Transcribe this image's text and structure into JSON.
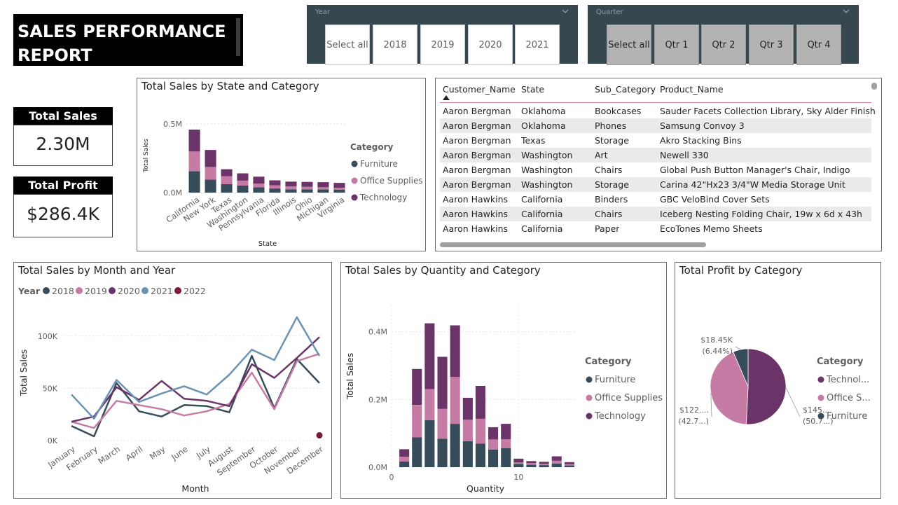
{
  "title": "SALES PERFORMANCE REPORT",
  "title_lines": [
    "SALES PERFORMANCE",
    "REPORT"
  ],
  "slicers": {
    "year": {
      "label": "Year",
      "options": [
        "Select all",
        "2018",
        "2019",
        "2020",
        "2021"
      ],
      "selected": []
    },
    "quarter": {
      "label": "Quarter",
      "options": [
        "Select all",
        "Qtr 1",
        "Qtr 2",
        "Qtr 3",
        "Qtr 4"
      ],
      "selected": [
        "Select all",
        "Qtr 1",
        "Qtr 2",
        "Qtr 3",
        "Qtr 4"
      ]
    }
  },
  "kpis": {
    "total_sales": {
      "label": "Total Sales",
      "value": "2.30M"
    },
    "total_profit": {
      "label": "Total Profit",
      "value": "$286.4K"
    }
  },
  "colors": {
    "furniture": "#374c5b",
    "office_supplies": "#c57ba3",
    "technology": "#6b3468",
    "y2018": "#374c5b",
    "y2019": "#c57ba3",
    "y2020": "#6b3468",
    "y2021": "#6b93b4",
    "y2022": "#7c1a3c"
  },
  "category_legend": {
    "title": "Category",
    "items": [
      "Furniture",
      "Office Supplies",
      "Technology"
    ]
  },
  "profit_legend": {
    "title": "Category",
    "items": [
      "Technol...",
      "Office S...",
      "Furniture"
    ]
  },
  "table": {
    "columns": [
      "Customer_Name",
      "State",
      "Sub_Category",
      "Product_Name"
    ],
    "rows": [
      [
        "Aaron Bergman",
        "Oklahoma",
        "Bookcases",
        "Sauder Facets Collection Library, Sky Alder Finish"
      ],
      [
        "Aaron Bergman",
        "Oklahoma",
        "Phones",
        "Samsung Convoy 3"
      ],
      [
        "Aaron Bergman",
        "Texas",
        "Storage",
        "Akro Stacking Bins"
      ],
      [
        "Aaron Bergman",
        "Washington",
        "Art",
        "Newell 330"
      ],
      [
        "Aaron Bergman",
        "Washington",
        "Chairs",
        "Global Push Button Manager's Chair, Indigo"
      ],
      [
        "Aaron Bergman",
        "Washington",
        "Storage",
        "Carina 42\"Hx23 3/4\"W Media Storage Unit"
      ],
      [
        "Aaron Hawkins",
        "California",
        "Binders",
        "GBC VeloBind Cover Sets"
      ],
      [
        "Aaron Hawkins",
        "California",
        "Chairs",
        "Iceberg Nesting Folding Chair, 19w x 6d x 43h"
      ],
      [
        "Aaron Hawkins",
        "California",
        "Paper",
        "EcoTones Memo Sheets"
      ]
    ]
  },
  "chart_data": [
    {
      "id": "state",
      "type": "bar",
      "stacked": true,
      "title": "Total Sales by State and Category",
      "xlabel": "State",
      "ylabel": "Total Sales",
      "yticks": [
        "0.0M",
        "0.5M"
      ],
      "ylim": [
        0,
        0.55
      ],
      "categories": [
        "California",
        "New York",
        "Texas",
        "Washington",
        "Pennsylvania",
        "Florida",
        "Illinois",
        "Ohio",
        "Michigan",
        "Virginia"
      ],
      "series": [
        {
          "name": "Furniture",
          "values": [
            0.156,
            0.094,
            0.061,
            0.051,
            0.039,
            0.03,
            0.024,
            0.024,
            0.024,
            0.022
          ]
        },
        {
          "name": "Office Supplies",
          "values": [
            0.143,
            0.092,
            0.058,
            0.036,
            0.027,
            0.023,
            0.021,
            0.018,
            0.016,
            0.014
          ]
        },
        {
          "name": "Technology",
          "values": [
            0.159,
            0.124,
            0.051,
            0.053,
            0.05,
            0.036,
            0.035,
            0.036,
            0.036,
            0.035
          ]
        }
      ],
      "legend": "right"
    },
    {
      "id": "month",
      "type": "line",
      "title": "Total Sales by Month and Year",
      "legend_title": "Year",
      "xlabel": "Month",
      "ylabel": "Total Sales",
      "yticks": [
        "0K",
        "50K",
        "100K"
      ],
      "ylim": [
        0,
        130
      ],
      "categories": [
        "January",
        "February",
        "March",
        "April",
        "May",
        "June",
        "July",
        "August",
        "September",
        "October",
        "November",
        "December"
      ],
      "series": [
        {
          "name": "2018",
          "values": [
            14,
            4,
            55,
            28,
            23,
            34,
            33,
            27,
            81,
            31,
            78,
            55
          ]
        },
        {
          "name": "2019",
          "values": [
            18,
            12,
            38,
            34,
            30,
            24,
            28,
            35,
            65,
            30,
            76,
            83
          ]
        },
        {
          "name": "2020",
          "values": [
            18,
            23,
            51,
            39,
            57,
            40,
            38,
            33,
            73,
            60,
            79,
            99
          ]
        },
        {
          "name": "2021",
          "values": [
            44,
            21,
            58,
            37,
            45,
            52,
            44,
            63,
            87,
            77,
            118,
            81
          ]
        },
        {
          "name": "2022",
          "values": [
            null,
            null,
            null,
            null,
            null,
            null,
            null,
            null,
            null,
            null,
            null,
            5
          ]
        }
      ],
      "legend": "top-left"
    },
    {
      "id": "quantity",
      "type": "bar",
      "stacked": true,
      "title": "Total Sales by Quantity and Category",
      "xlabel": "Quantity",
      "ylabel": "Total Sales",
      "yticks": [
        "0.0M",
        "0.2M",
        "0.4M"
      ],
      "ylim": [
        0,
        0.48
      ],
      "xticks": [
        0,
        10
      ],
      "xlim": [
        0,
        14.5
      ],
      "categories": [
        1,
        2,
        3,
        4,
        5,
        6,
        7,
        8,
        9,
        10,
        11,
        12,
        13,
        14
      ],
      "series": [
        {
          "name": "Furniture",
          "values": [
            0.017,
            0.088,
            0.139,
            0.084,
            0.128,
            0.077,
            0.07,
            0.052,
            0.056,
            0.01,
            0.007,
            0.006,
            0.011,
            0.005
          ]
        },
        {
          "name": "Office Supplies",
          "values": [
            0.014,
            0.096,
            0.092,
            0.088,
            0.139,
            0.063,
            0.073,
            0.03,
            0.026,
            0.004,
            0.005,
            0.004,
            0.008,
            0.004
          ]
        },
        {
          "name": "Technology",
          "values": [
            0.022,
            0.106,
            0.194,
            0.154,
            0.152,
            0.065,
            0.097,
            0.036,
            0.046,
            0.011,
            0.006,
            0.006,
            0.013,
            0.006
          ]
        }
      ],
      "legend": "right"
    },
    {
      "id": "profit",
      "type": "pie",
      "title": "Total Profit by Category",
      "slices": [
        {
          "name": "Technology",
          "value": 145.45,
          "label": "$145....",
          "pct_label": "(50.7...)"
        },
        {
          "name": "Office Supplies",
          "value": 122.49,
          "label": "$122....",
          "pct_label": "(42.7...)"
        },
        {
          "name": "Furniture",
          "value": 18.45,
          "label": "$18.45K",
          "pct_label": "(6.44%)"
        }
      ],
      "legend": "right"
    }
  ]
}
